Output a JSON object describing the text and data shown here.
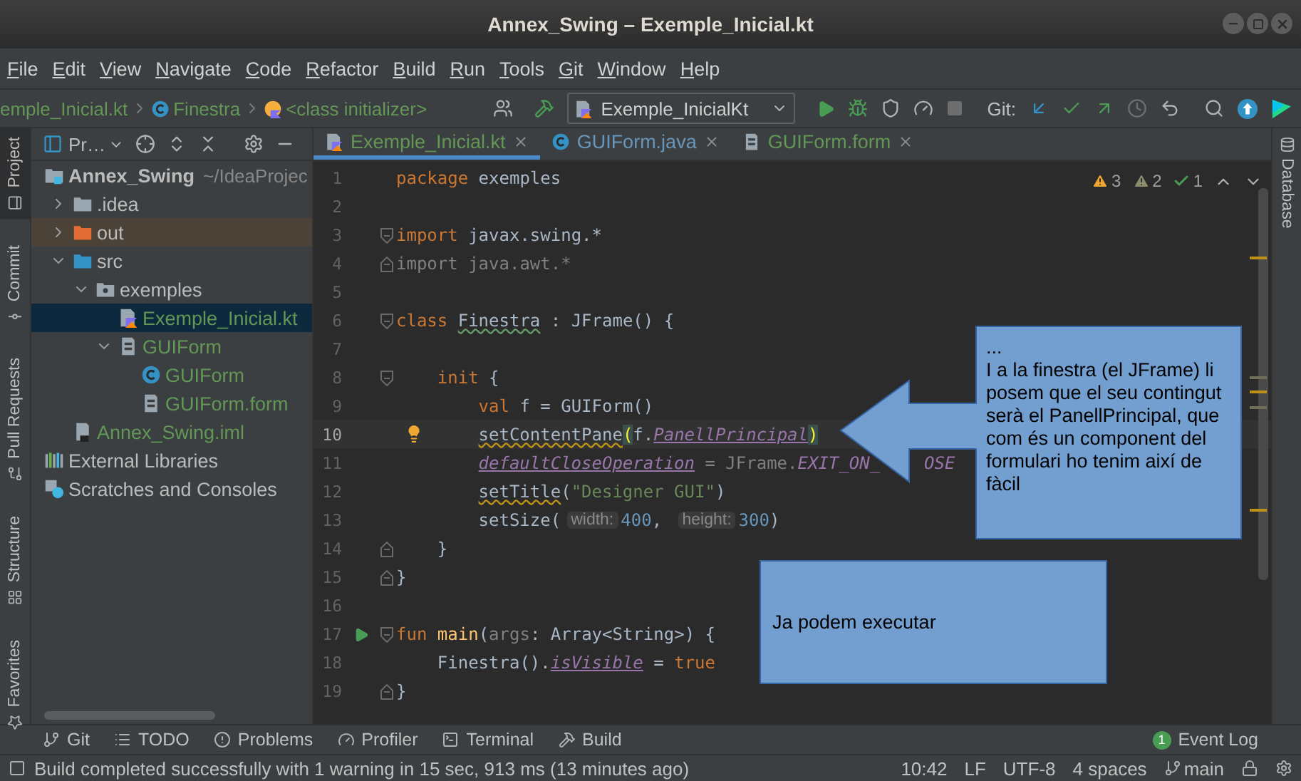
{
  "window": {
    "title": "Annex_Swing – Exemple_Inicial.kt"
  },
  "menu": [
    "File",
    "Edit",
    "View",
    "Navigate",
    "Code",
    "Refactor",
    "Build",
    "Run",
    "Tools",
    "Git",
    "Window",
    "Help"
  ],
  "breadcrumbs": [
    {
      "label": "emple_Inicial.kt",
      "kind": "file"
    },
    {
      "label": "Finestra",
      "kind": "class"
    },
    {
      "label": "<class initializer>",
      "kind": "initializer"
    }
  ],
  "toolbar": {
    "run_config": "Exemple_InicialKt",
    "git_label": "Git:"
  },
  "left_stripe": [
    {
      "label": "Project",
      "kind": "project",
      "selected": true
    },
    {
      "label": "Commit",
      "kind": "commit",
      "selected": false
    },
    {
      "label": "Pull Requests",
      "kind": "pull",
      "selected": false
    },
    {
      "label": "Structure",
      "kind": "structure",
      "selected": false
    },
    {
      "label": "Favorites",
      "kind": "favorites",
      "selected": false
    }
  ],
  "project_panel": {
    "title": "Pr…",
    "tree": [
      {
        "label": "Annex_Swing",
        "path": "~/IdeaProjec",
        "kind": "module",
        "color": "#bbbbbb",
        "selected": false,
        "children": [
          {
            "label": ".idea",
            "kind": "folder",
            "color": "#bbbbbb",
            "selected": false,
            "expanded": false
          },
          {
            "label": "out",
            "kind": "excluded-folder",
            "color": "#bbbbbb",
            "selected": false,
            "expanded": false
          },
          {
            "label": "src",
            "kind": "source-folder",
            "color": "#bbbbbb",
            "selected": false,
            "expanded": true,
            "children": [
              {
                "label": "exemples",
                "kind": "package",
                "color": "#bbbbbb",
                "selected": false,
                "expanded": true,
                "children": [
                  {
                    "label": "Exemple_Inicial.kt",
                    "kind": "kotlin-file",
                    "color": "#629755",
                    "selected": true
                  },
                  {
                    "label": "GUIForm",
                    "kind": "form-group",
                    "color": "#629755",
                    "selected": false,
                    "expanded": true,
                    "children": [
                      {
                        "label": "GUIForm",
                        "kind": "class",
                        "color": "#629755",
                        "selected": false
                      },
                      {
                        "label": "GUIForm.form",
                        "kind": "form-file",
                        "color": "#629755",
                        "selected": false
                      }
                    ]
                  }
                ]
              }
            ]
          },
          {
            "label": "Annex_Swing.iml",
            "kind": "iml",
            "color": "#629755",
            "selected": false
          }
        ]
      },
      {
        "label": "External Libraries",
        "kind": "libraries",
        "color": "#bbbbbb",
        "selected": false
      },
      {
        "label": "Scratches and Consoles",
        "kind": "scratches",
        "color": "#bbbbbb",
        "selected": false
      }
    ]
  },
  "editor": {
    "tabs": [
      {
        "label": "Exemple_Inicial.kt",
        "kind": "kotlin-file",
        "color": "#629755",
        "selected": true
      },
      {
        "label": "GUIForm.java",
        "kind": "class",
        "color": "#6897bb",
        "selected": false
      },
      {
        "label": "GUIForm.form",
        "kind": "form-file",
        "color": "#629755",
        "selected": false
      }
    ],
    "inspections": [
      {
        "kind": "warning",
        "count": "3"
      },
      {
        "kind": "weak-warning",
        "count": "2"
      },
      {
        "kind": "typo",
        "count": "1"
      }
    ],
    "lines": [
      {
        "number": "1",
        "kind": "code",
        "tokens": [
          {
            "t": "package",
            "kind": "kw"
          },
          {
            "t": " exemples",
            "kind": "plain"
          }
        ]
      },
      {
        "number": "2",
        "kind": "code"
      },
      {
        "number": "3",
        "kind": "code",
        "fold": {
          "kind": "start"
        },
        "tokens": [
          {
            "t": "import",
            "kind": "kw"
          },
          {
            "t": " javax.swing.*",
            "kind": "plain"
          }
        ]
      },
      {
        "number": "4",
        "kind": "code",
        "fold": {
          "kind": "end"
        },
        "tokens": [
          {
            "t": "import java.awt.*",
            "kind": "dim"
          }
        ]
      },
      {
        "number": "5",
        "kind": "code"
      },
      {
        "number": "6",
        "kind": "code",
        "fold": {
          "kind": "start"
        },
        "tokens": [
          {
            "t": "class ",
            "kind": "kw"
          },
          {
            "t": "Finestra",
            "kind": "plain",
            "underline": {
              "kind": "typo"
            }
          },
          {
            "t": " : JFrame() {",
            "kind": "plain"
          }
        ]
      },
      {
        "number": "7",
        "kind": "code"
      },
      {
        "number": "8",
        "kind": "code",
        "fold": {
          "kind": "start"
        },
        "tokens": [
          {
            "kind": "indent"
          },
          {
            "t": "init",
            "kind": "kw"
          },
          {
            "t": " {",
            "kind": "plain"
          }
        ]
      },
      {
        "number": "9",
        "kind": "code",
        "tokens": [
          {
            "kind": "indent"
          },
          {
            "kind": "indent"
          },
          {
            "t": "val",
            "kind": "kw"
          },
          {
            "t": " f = GUIForm()",
            "kind": "plain"
          }
        ]
      },
      {
        "number": "10",
        "kind": "bulb",
        "current": true,
        "tokens": [
          {
            "kind": "indent"
          },
          {
            "kind": "indent"
          },
          {
            "t": "setContentPane",
            "kind": "plain",
            "underline": {
              "kind": "warn"
            }
          },
          {
            "t": "(",
            "kind": "brace"
          },
          {
            "t": "f.",
            "kind": "plain"
          },
          {
            "t": "PanellPrincipal",
            "kind": "prop"
          },
          {
            "t": ")",
            "kind": "brace"
          }
        ]
      },
      {
        "number": "11",
        "kind": "code",
        "tokens": [
          {
            "kind": "indent"
          },
          {
            "kind": "indent"
          },
          {
            "t": "defaultCloseOperation",
            "kind": "prop"
          },
          {
            "t": " = JFrame.",
            "kind": "dim"
          },
          {
            "t": "EXIT_ON_",
            "kind": "const"
          },
          {
            "kind": "covered"
          },
          {
            "t": "OSE",
            "kind": "const"
          }
        ]
      },
      {
        "number": "12",
        "kind": "code",
        "tokens": [
          {
            "kind": "indent"
          },
          {
            "kind": "indent"
          },
          {
            "t": "setTitle",
            "kind": "plain",
            "underline": {
              "kind": "warn"
            }
          },
          {
            "t": "(",
            "kind": "plain"
          },
          {
            "t": "\"Designer GUI\"",
            "kind": "str"
          },
          {
            "t": ")",
            "kind": "plain"
          }
        ]
      },
      {
        "number": "13",
        "kind": "code",
        "tokens": [
          {
            "kind": "indent"
          },
          {
            "kind": "indent"
          },
          {
            "t": "setSize(",
            "kind": "plain"
          },
          {
            "t": "width:",
            "kind": "hint"
          },
          {
            "t": "400",
            "kind": "num"
          },
          {
            "t": ", ",
            "kind": "plain"
          },
          {
            "t": "height:",
            "kind": "hint"
          },
          {
            "t": "300",
            "kind": "num"
          },
          {
            "t": ")",
            "kind": "plain"
          }
        ]
      },
      {
        "number": "14",
        "kind": "code",
        "fold": {
          "kind": "end"
        },
        "tokens": [
          {
            "kind": "indent"
          },
          {
            "t": "}",
            "kind": "plain"
          }
        ]
      },
      {
        "number": "15",
        "kind": "code",
        "fold": {
          "kind": "end"
        },
        "tokens": [
          {
            "t": "}",
            "kind": "plain"
          }
        ]
      },
      {
        "number": "16",
        "kind": "code"
      },
      {
        "number": "17",
        "kind": "run",
        "fold": {
          "kind": "start"
        },
        "tokens": [
          {
            "t": "fun ",
            "kind": "kw"
          },
          {
            "t": "main",
            "kind": "fn"
          },
          {
            "t": "(",
            "kind": "plain"
          },
          {
            "t": "args",
            "kind": "dim"
          },
          {
            "t": ": Array<String>) {",
            "kind": "plain"
          }
        ]
      },
      {
        "number": "18",
        "kind": "code",
        "tokens": [
          {
            "kind": "indent"
          },
          {
            "t": "Finestra().",
            "kind": "plain"
          },
          {
            "t": "isVisible",
            "kind": "prop"
          },
          {
            "t": " = ",
            "kind": "plain"
          },
          {
            "t": "true",
            "kind": "kw"
          }
        ]
      },
      {
        "number": "19",
        "kind": "code",
        "fold": {
          "kind": "end"
        },
        "tokens": [
          {
            "t": "}",
            "kind": "plain"
          }
        ]
      }
    ]
  },
  "callouts": [
    {
      "kind": "arrow",
      "paragraphs": [
        "...",
        "I a la finestra (el JFrame) li posem que el seu contingut serà el PanellPrincipal, que com és un component del formulari ho tenim així de fàcil"
      ]
    },
    {
      "kind": "box",
      "paragraphs": [
        "Ja podem executar"
      ]
    }
  ],
  "right_stripe": [
    {
      "label": "Database",
      "selected": false
    }
  ],
  "tool_windows": [
    {
      "label": "Git",
      "kind": "git"
    },
    {
      "label": "TODO",
      "kind": "todo"
    },
    {
      "label": "Problems",
      "kind": "problems"
    },
    {
      "label": "Profiler",
      "kind": "profiler"
    },
    {
      "label": "Terminal",
      "kind": "terminal"
    },
    {
      "label": "Build",
      "kind": "build"
    }
  ],
  "event_log": {
    "label": "Event Log",
    "badge": "1"
  },
  "status_bar": {
    "message": "Build completed successfully with 1 warning in 15 sec, 913 ms (13 minutes ago)",
    "items": [
      {
        "label": "10:42",
        "kind": "text"
      },
      {
        "label": "LF",
        "kind": "text"
      },
      {
        "label": "UTF-8",
        "kind": "text"
      },
      {
        "label": "4 spaces",
        "kind": "text"
      },
      {
        "label": "main",
        "kind": "branch"
      }
    ]
  }
}
